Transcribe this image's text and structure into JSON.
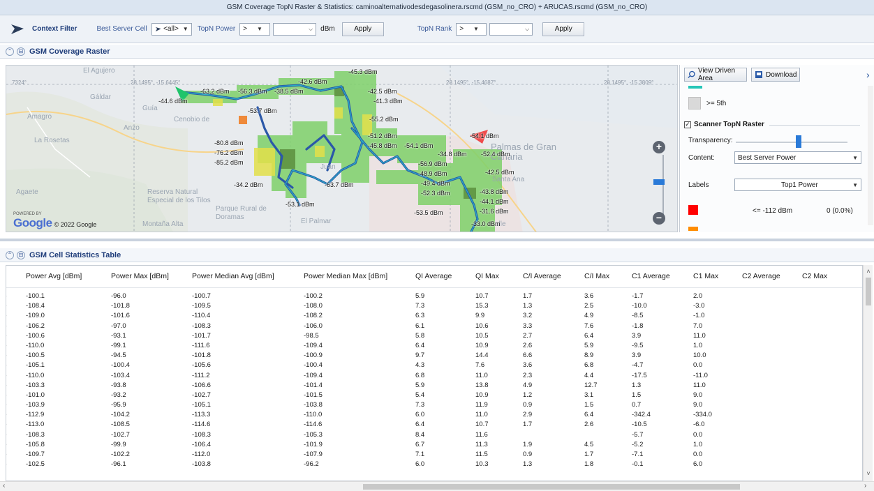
{
  "window": {
    "title": "GSM Coverage TopN Raster & Statistics:  caminoalternativodesdegasolinera.rscmd (GSM_no_CRO)  +  ARUCAS.rscmd (GSM_no_CRO)"
  },
  "filter": {
    "context_label": "Context Filter",
    "best_server_label": "Best Server Cell",
    "best_server_value": "<all>",
    "topn_power_label": "TopN Power",
    "topn_power_op": ">",
    "topn_power_value": "",
    "unit": "dBm",
    "apply_label": "Apply",
    "topn_rank_label": "TopN Rank",
    "topn_rank_op": ">",
    "topn_rank_value": "",
    "apply2_label": "Apply"
  },
  "raster_section": {
    "title": "GSM Coverage Raster"
  },
  "map": {
    "coords": [
      "7324°",
      "28.1495°, -15.6445°",
      "28.1495°, -15.4687°",
      "28.1495°, -15.3809°"
    ],
    "places": [
      "El Agujero",
      "Gáldar",
      "Guía",
      "Amagro",
      "Anzo",
      "La Rosetas",
      "Agaete",
      "Reserva Natural Especial de los Tilos",
      "Parque Rural de Doramas",
      "Montaña Alta",
      "El Palmar",
      "Palmas de Gran Canaria",
      "Santa Ana",
      "Cenobio de",
      "Juan",
      "alle"
    ],
    "labels": [
      "-45.3 dBm",
      "-42.6 dBm",
      "-63.2 dBm",
      "-56.3 dBm",
      "-38.5 dBm",
      "-42.5 dBm",
      "-44.6 dBm",
      "-41.3 dBm",
      "-53.7 dBm",
      "-55.2 dBm",
      "-51.2 dBm",
      "-54.1 dBm",
      "-80.8 dBm",
      "-45.8 dBm",
      "-54.1 dBm",
      "-34.8 dBm",
      "-52.4 dBm",
      "-76.2 dBm",
      "-85.2 dBm",
      "-56.9 dBm",
      "-48.9 dBm",
      "-42.5 dBm",
      "-34.2 dBm",
      "-63.7 dBm",
      "-49.4 dBm",
      "-52.3 dBm",
      "-43.8 dBm",
      "-53.1 dBm",
      "-44.1 dBm",
      "-31.6 dBm",
      "-53.5 dBm",
      "-33.0 dBm"
    ],
    "google_powered": "POWERED BY",
    "google_logo": "Google",
    "google_copy": "© 2022 Google"
  },
  "right_panel": {
    "view_driven_area": "View Driven Area",
    "download": "Download",
    "legend_top": ">= 5th",
    "scanner_label": "Scanner TopN Raster",
    "transparency_label": "Transparency:",
    "content_label": "Content:",
    "content_value": "Best Server Power",
    "labels_label": "Labels",
    "labels_value": "Top1 Power",
    "legend_range": "<= -112 dBm",
    "legend_count": "0 (0.0%)",
    "colors": {
      "red": "#ff0000",
      "orange": "#ff8c00",
      "gray": "#d9d9d9",
      "teal": "#26c6b8",
      "blue": "#2a7ad8"
    }
  },
  "stats_section": {
    "title": "GSM Cell Statistics Table"
  },
  "table": {
    "headers": [
      "Power Avg [dBm]",
      "Power Max [dBm]",
      "Power Median Avg [dBm]",
      "Power Median Max [dBm]",
      "QI Average",
      "QI Max",
      "C/I Average",
      "C/I Max",
      "C1 Average",
      "C1 Max",
      "C2 Average",
      "C2 Max"
    ],
    "rows": [
      [
        "-100.1",
        "-96.0",
        "-100.7",
        "-100.2",
        "5.9",
        "10.7",
        "1.7",
        "3.6",
        "-1.7",
        "2.0",
        "",
        ""
      ],
      [
        "-108.4",
        "-101.8",
        "-109.5",
        "-108.0",
        "7.3",
        "15.3",
        "1.3",
        "2.5",
        "-10.0",
        "-3.0",
        "",
        ""
      ],
      [
        "-109.0",
        "-101.6",
        "-110.4",
        "-108.2",
        "6.3",
        "9.9",
        "3.2",
        "4.9",
        "-8.5",
        "-1.0",
        "",
        ""
      ],
      [
        "-106.2",
        "-97.0",
        "-108.3",
        "-106.0",
        "6.1",
        "10.6",
        "3.3",
        "7.6",
        "-1.8",
        "7.0",
        "",
        ""
      ],
      [
        "-100.6",
        "-93.1",
        "-101.7",
        "-98.5",
        "5.8",
        "10.5",
        "2.7",
        "6.4",
        "3.9",
        "11.0",
        "",
        ""
      ],
      [
        "-110.0",
        "-99.1",
        "-111.6",
        "-109.4",
        "6.4",
        "10.9",
        "2.6",
        "5.9",
        "-9.5",
        "1.0",
        "",
        ""
      ],
      [
        "-100.5",
        "-94.5",
        "-101.8",
        "-100.9",
        "9.7",
        "14.4",
        "6.6",
        "8.9",
        "3.9",
        "10.0",
        "",
        ""
      ],
      [
        "-105.1",
        "-100.4",
        "-105.6",
        "-100.4",
        "4.3",
        "7.6",
        "3.6",
        "6.8",
        "-4.7",
        "0.0",
        "",
        ""
      ],
      [
        "-110.0",
        "-103.4",
        "-111.2",
        "-109.4",
        "6.8",
        "11.0",
        "2.3",
        "4.4",
        "-17.5",
        "-11.0",
        "",
        ""
      ],
      [
        "-103.3",
        "-93.8",
        "-106.6",
        "-101.4",
        "5.9",
        "13.8",
        "4.9",
        "12.7",
        "1.3",
        "11.0",
        "",
        ""
      ],
      [
        "-101.0",
        "-93.2",
        "-102.7",
        "-101.5",
        "5.4",
        "10.9",
        "1.2",
        "3.1",
        "1.5",
        "9.0",
        "",
        ""
      ],
      [
        "-103.9",
        "-95.9",
        "-105.1",
        "-103.8",
        "7.3",
        "11.9",
        "0.9",
        "1.5",
        "0.7",
        "9.0",
        "",
        ""
      ],
      [
        "-112.9",
        "-104.2",
        "-113.3",
        "-110.0",
        "6.0",
        "11.0",
        "2.9",
        "6.4",
        "-342.4",
        "-334.0",
        "",
        ""
      ],
      [
        "-113.0",
        "-108.5",
        "-114.6",
        "-114.6",
        "6.4",
        "10.7",
        "1.7",
        "2.6",
        "-10.5",
        "-6.0",
        "",
        ""
      ],
      [
        "-108.3",
        "-102.7",
        "-108.3",
        "-105.3",
        "8.4",
        "11.6",
        "",
        "",
        "-5.7",
        "0.0",
        "",
        ""
      ],
      [
        "-105.8",
        "-99.9",
        "-106.4",
        "-101.9",
        "6.7",
        "11.3",
        "1.9",
        "4.5",
        "-5.2",
        "1.0",
        "",
        ""
      ],
      [
        "-109.7",
        "-102.2",
        "-112.0",
        "-107.9",
        "7.1",
        "11.5",
        "0.9",
        "1.7",
        "-7.1",
        "0.0",
        "",
        ""
      ],
      [
        "-102.5",
        "-96.1",
        "-103.8",
        "-96.2",
        "6.0",
        "10.3",
        "1.3",
        "1.8",
        "-0.1",
        "6.0",
        "",
        ""
      ]
    ]
  }
}
